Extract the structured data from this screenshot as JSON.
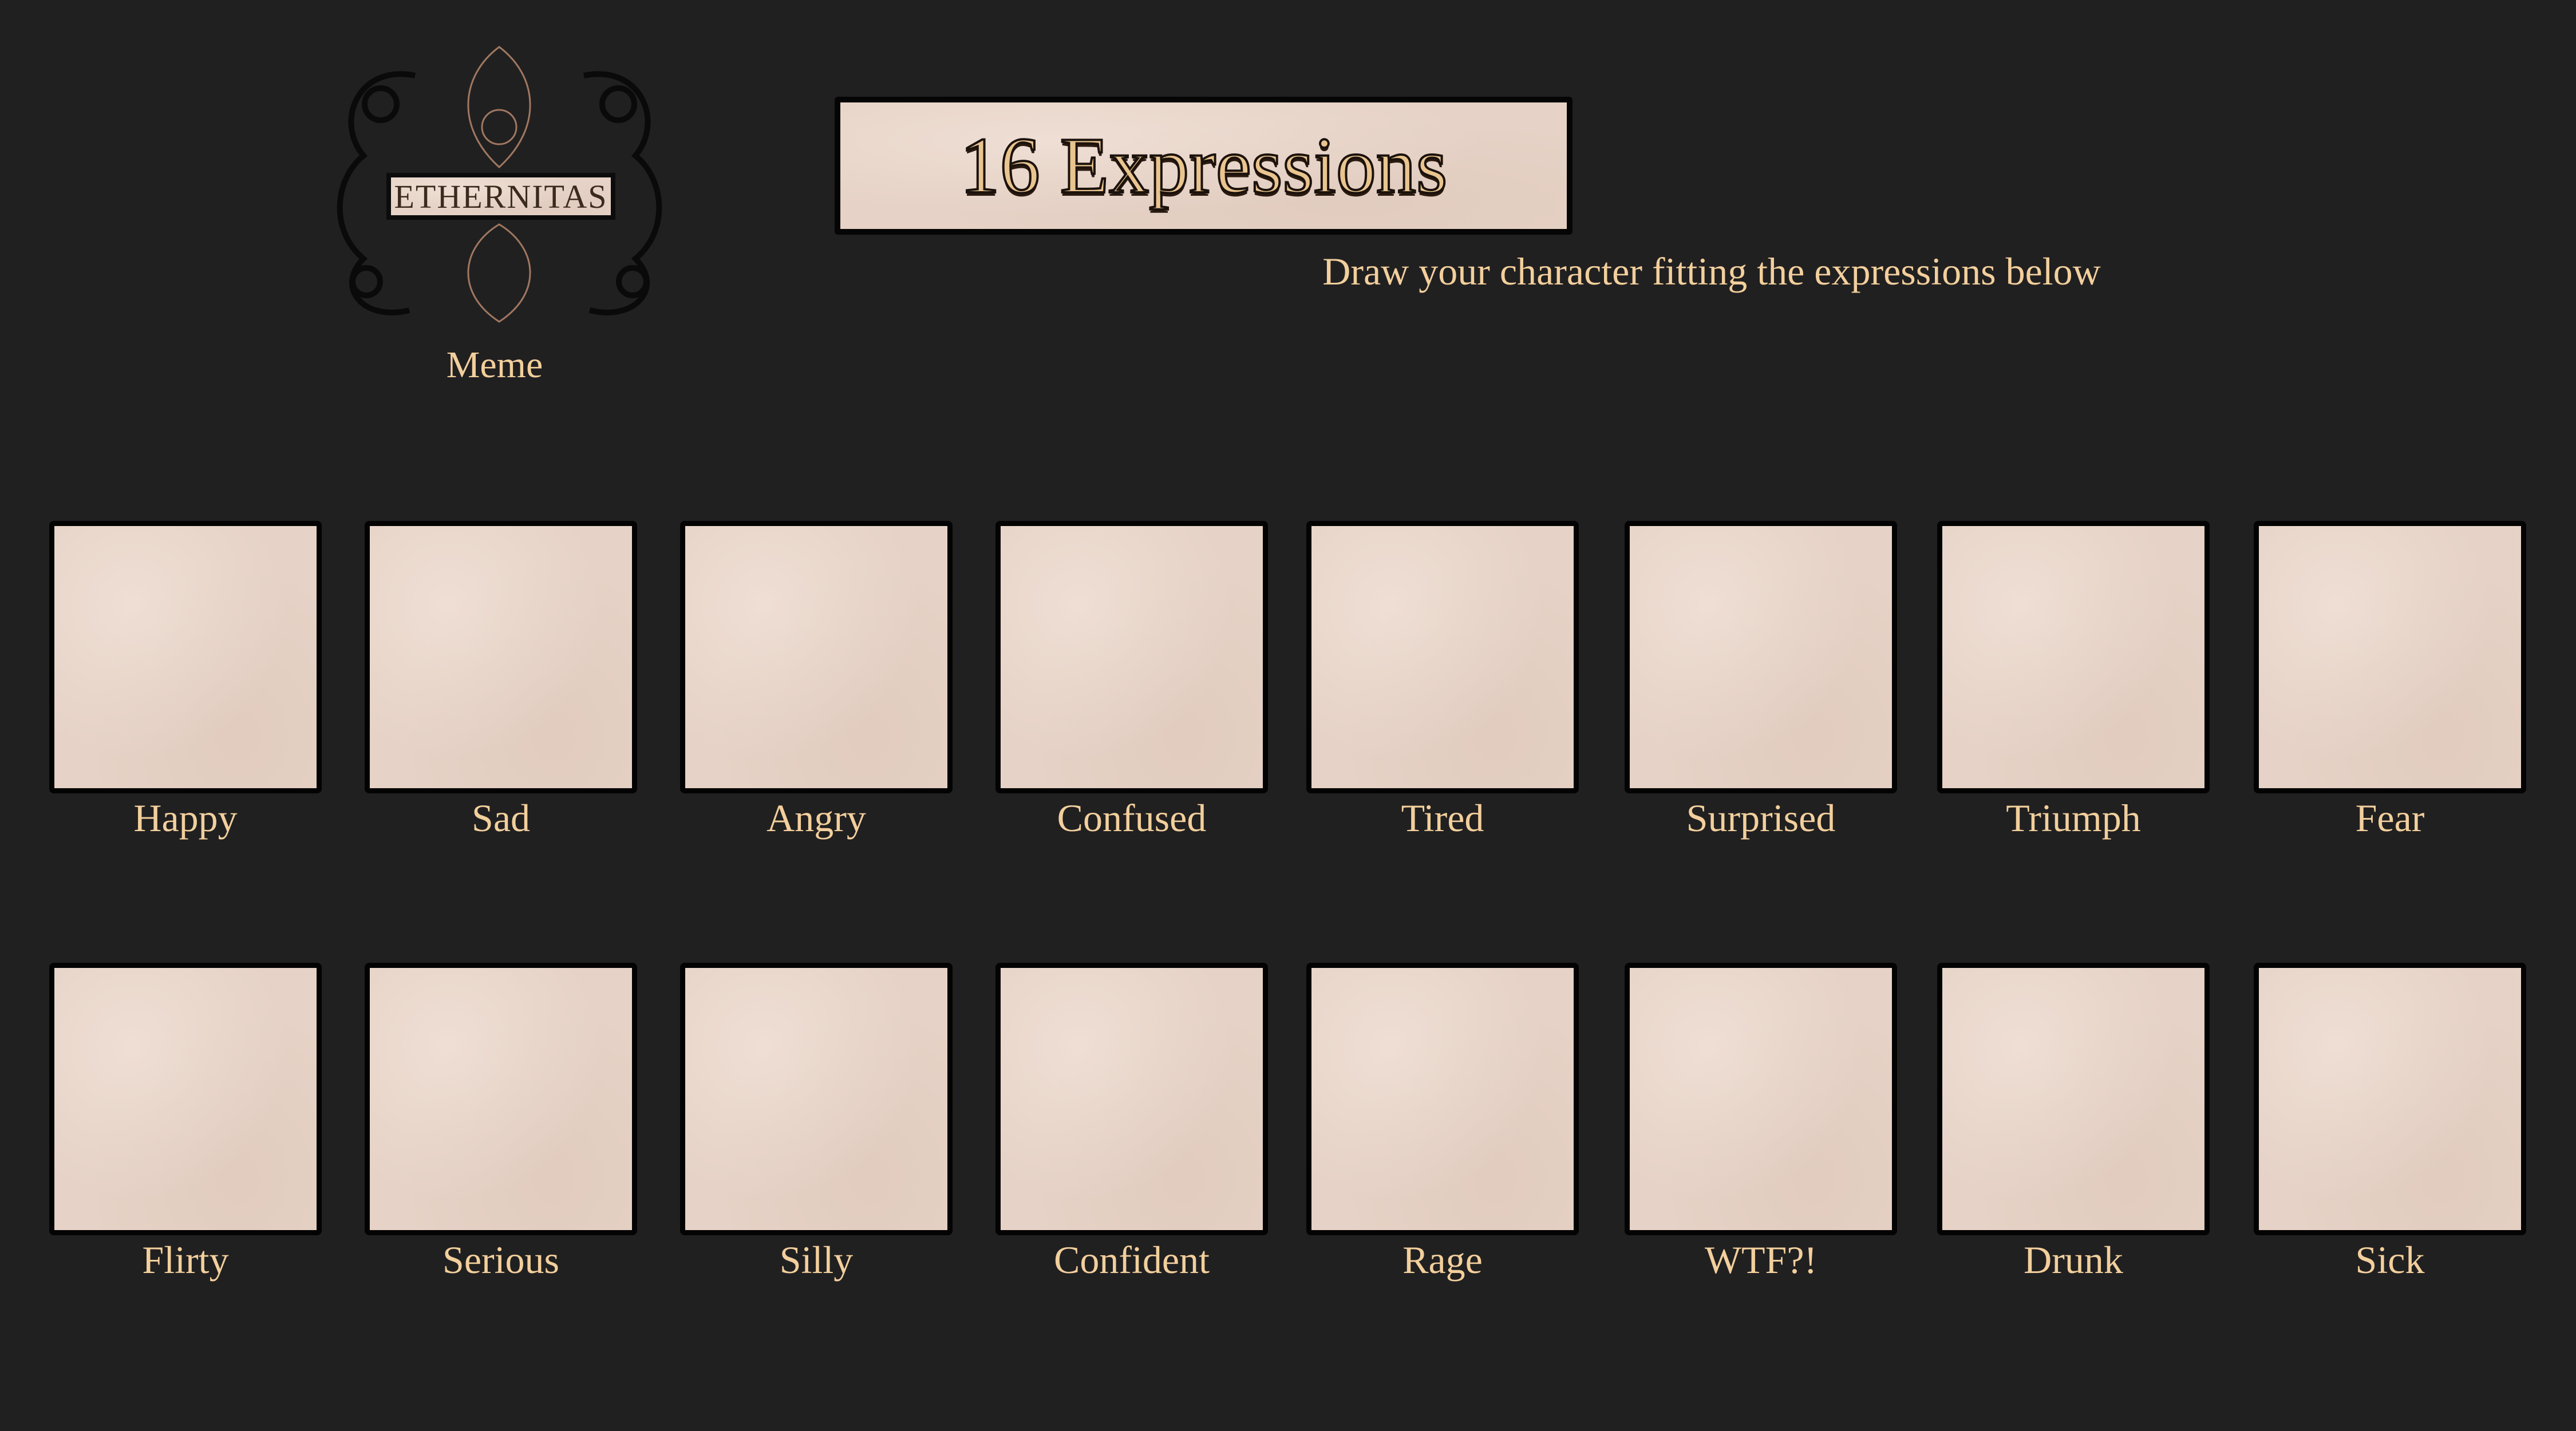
{
  "logo": {
    "text": "ETHERNITAS",
    "caption": "Meme"
  },
  "header": {
    "title": "16 Expressions",
    "subtitle": "Draw your character fitting the expressions below"
  },
  "colors": {
    "background": "#212021",
    "panel": "#e6d2c6",
    "label": "#f2cf9c",
    "border": "#030303"
  },
  "expressions": [
    [
      "Happy",
      "Sad",
      "Angry",
      "Confused",
      "Tired",
      "Surprised",
      "Triumph",
      "Fear"
    ],
    [
      "Flirty",
      "Serious",
      "Silly",
      "Confident",
      "Rage",
      "WTF?!",
      "Drunk",
      "Sick"
    ]
  ]
}
